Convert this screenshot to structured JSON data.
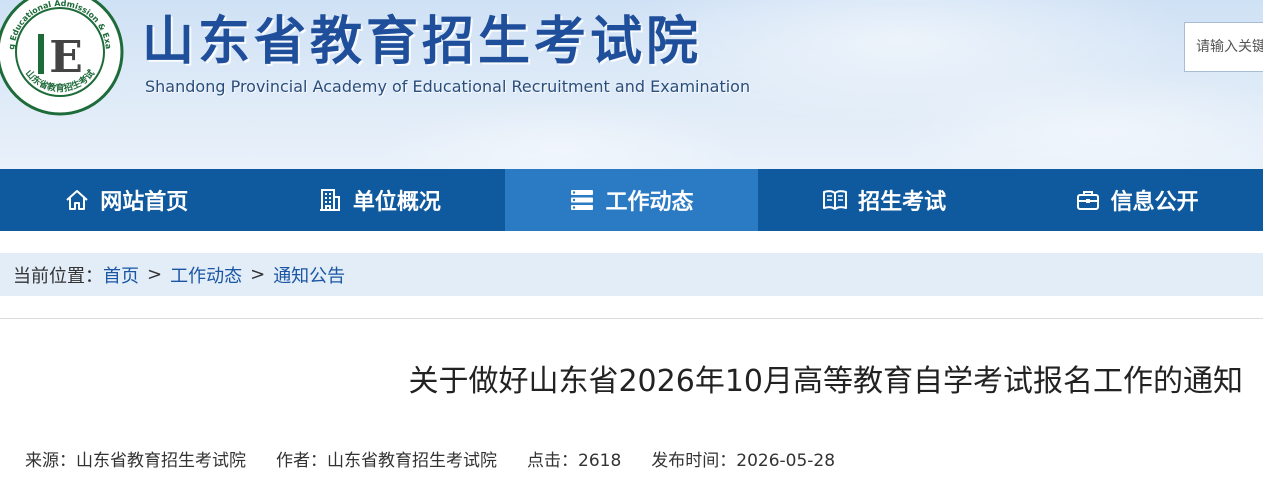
{
  "header": {
    "title_cn": "山东省教育招生考试院",
    "title_en": "Shandong Provincial Academy of Educational Recruitment and Examination",
    "seal_text_outer": "Shandong Educational Admission & Examination",
    "seal_text_cn": "山东省教育招生考试",
    "seal_letter": "E",
    "search_placeholder": "请输入关键"
  },
  "nav": {
    "items": [
      {
        "label": "网站首页",
        "icon": "home-icon",
        "active": false
      },
      {
        "label": "单位概况",
        "icon": "building-icon",
        "active": false
      },
      {
        "label": "工作动态",
        "icon": "list-icon",
        "active": true
      },
      {
        "label": "招生考试",
        "icon": "book-icon",
        "active": false
      },
      {
        "label": "信息公开",
        "icon": "briefcase-icon",
        "active": false
      }
    ]
  },
  "breadcrumb": {
    "prefix": "当前位置：",
    "items": [
      "首页",
      "工作动态",
      "通知公告"
    ],
    "separator": ">"
  },
  "article": {
    "title": "关于做好山东省2026年10月高等教育自学考试报名工作的通知",
    "source": "来源：山东省教育招生考试院",
    "author": "作者：山东省教育招生考试院",
    "clicks": "点击：2618",
    "published": "发布时间：2026-05-28"
  },
  "colors": {
    "nav_bg": "#0f5a9e",
    "nav_active": "#2b7bc4",
    "title_blue": "#1f4e9a",
    "crumb_bg": "#e3edf8",
    "seal_green": "#1e6b3a"
  }
}
